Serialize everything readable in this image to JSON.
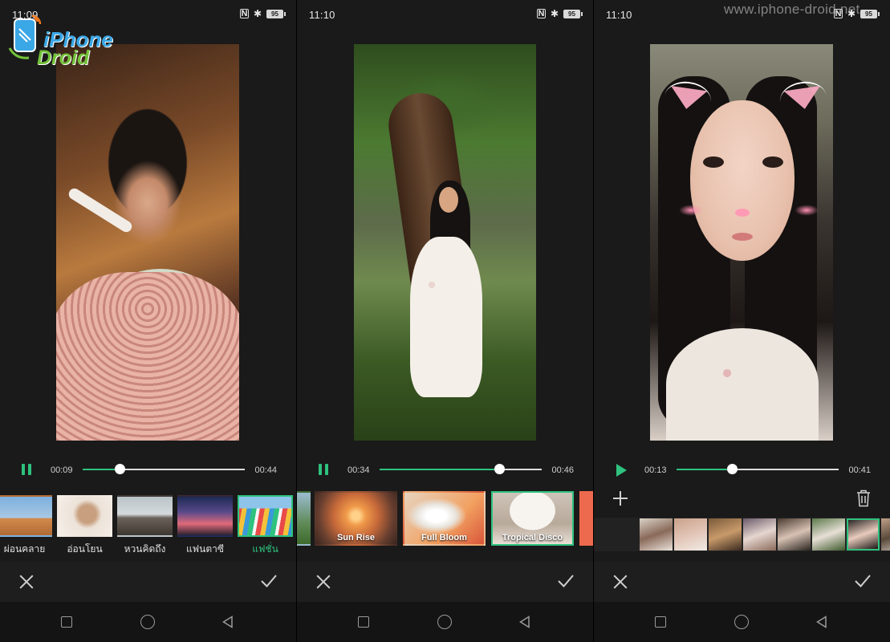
{
  "watermark": "www.iphone-droid.net",
  "logo": {
    "line1": "iPhone",
    "line2": "Droid"
  },
  "screens": [
    {
      "status": {
        "time": "11:09",
        "battery": "95"
      },
      "player": {
        "state": "pause",
        "current": "00:09",
        "total": "00:44",
        "progress": 0.23
      },
      "filters": [
        {
          "label": "ผ่อนคลาย",
          "selected": false
        },
        {
          "label": "อ่อนโยน",
          "selected": false
        },
        {
          "label": "หวนคิดถึง",
          "selected": false
        },
        {
          "label": "แฟนตาซี",
          "selected": false
        },
        {
          "label": "แฟชั่น",
          "selected": true
        }
      ]
    },
    {
      "status": {
        "time": "11:10",
        "battery": "95"
      },
      "player": {
        "state": "pause",
        "current": "00:34",
        "total": "00:46",
        "progress": 0.74
      },
      "looks": [
        {
          "label": "",
          "selected": false
        },
        {
          "label": "Sun Rise",
          "selected": false
        },
        {
          "label": "Full Bloom",
          "selected": false
        },
        {
          "label": "Tropical Disco",
          "selected": true
        },
        {
          "label": "",
          "selected": false
        }
      ]
    },
    {
      "status": {
        "time": "11:10",
        "battery": "95"
      },
      "player": {
        "state": "play",
        "current": "00:13",
        "total": "00:41",
        "progress": 0.34
      },
      "clip_count": 8,
      "selected_clip": 6
    }
  ],
  "colors": {
    "accent": "#2ec27e",
    "background": "#1a1a1a"
  }
}
